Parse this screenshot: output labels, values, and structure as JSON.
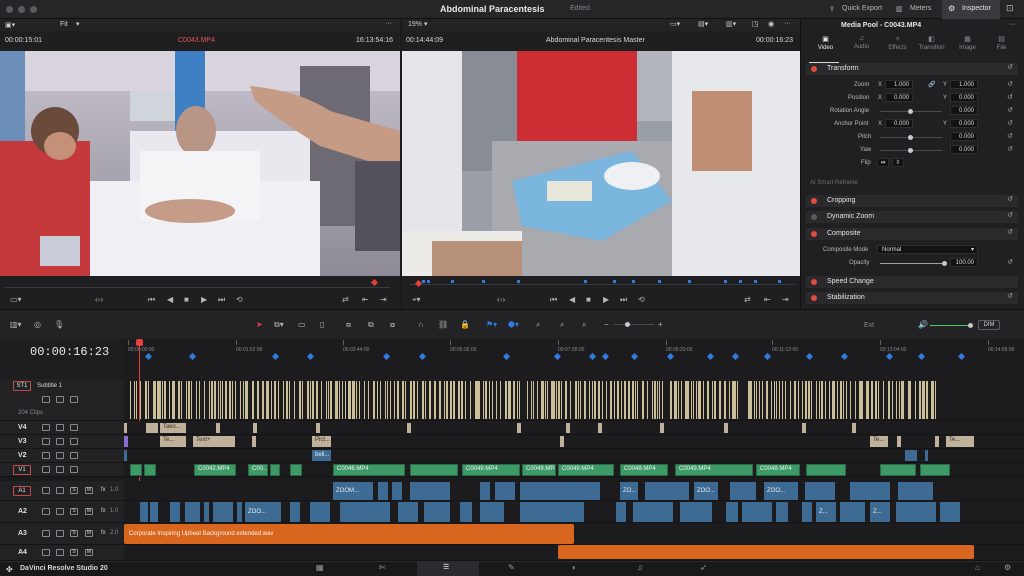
{
  "app": {
    "title": "Abdominal Paracentesis",
    "status": "Edited",
    "brand": "DaVinci Resolve Studio 20"
  },
  "top": {
    "quick_export": "Quick Export",
    "meters": "Meters",
    "inspector": "Inspector"
  },
  "viewer_left": {
    "zoom": "Fit",
    "timecode": "00:00:15:01",
    "clip": "C0043.MP4",
    "duration": "16:13:54:16"
  },
  "viewer_right": {
    "zoom": "19%",
    "timecode": "00:14:44:09",
    "clip": "Abdominal Paracentesis Master",
    "duration": "00:00:16:23"
  },
  "inspector": {
    "title": "Media Pool - C0043.MP4",
    "tabs": [
      "Video",
      "Audio",
      "Effects",
      "Transition",
      "Image",
      "File"
    ],
    "transform": "Transform",
    "zoom_label": "Zoom",
    "zoom_x": "1.000",
    "zoom_y": "1.000",
    "position_label": "Position",
    "pos_x": "0.000",
    "pos_y": "0.000",
    "rotation_label": "Rotation Angle",
    "rotation": "0.000",
    "anchor_label": "Anchor Point",
    "anchor_x": "0.000",
    "anchor_y": "0.000",
    "pitch_label": "Pitch",
    "pitch": "0.000",
    "yaw_label": "Yaw",
    "yaw": "0.000",
    "flip_label": "Flip",
    "smart_reframe": "AI Smart Reframe",
    "cropping": "Cropping",
    "dynamic_zoom": "Dynamic Zoom",
    "composite": "Composite",
    "composite_mode_label": "Composite Mode",
    "composite_mode": "Normal",
    "opacity_label": "Opacity",
    "opacity": "100.00",
    "speed_change": "Speed Change",
    "stabilization": "Stabilization",
    "x": "X",
    "y": "Y"
  },
  "toolbar": {
    "ext": "Ext",
    "dim": "DIM"
  },
  "timeline": {
    "timecode": "00:00:16:23",
    "ticks": [
      "00:00:00:00",
      "00:01:52:00",
      "00:03:44:00",
      "00:05:36:00",
      "00:07:28:00",
      "00:09:20:00",
      "00:11:12:00",
      "00:13:04:00",
      "00:14:56:00"
    ],
    "subtitle_track": {
      "badge": "ST1",
      "name": "Subtitle 1",
      "clips": "204 Clips"
    },
    "tracks": [
      "V4",
      "V3",
      "V2",
      "V1",
      "A1",
      "A2",
      "A3",
      "A4"
    ],
    "fx_a1": "1.0",
    "fx_a2": "1.0",
    "fx_a3": "2.0",
    "v4_clips": [
      "Tako..."
    ],
    "v3_clips": [
      "Te...",
      "Text+",
      "Pict...",
      "Te...",
      "Te..."
    ],
    "v2_clips": [
      "bell..."
    ],
    "v1_clips": [
      "C0042.MP4",
      "C00...",
      "C0046.MP4",
      "C0049.MP4",
      "C0049.MP4",
      "C0049.MP4",
      "C0049.MP4",
      "C0049.MP4",
      "C0049.MP4"
    ],
    "a1_clips": [
      "ZOOM...",
      "ZO...",
      "ZOO...",
      "ZOO..."
    ],
    "a2_clips": [
      "ZOO...",
      "Z...",
      "Z..."
    ],
    "a3_music": "Corporate Inspiring Upbeat Background extended.wav"
  }
}
